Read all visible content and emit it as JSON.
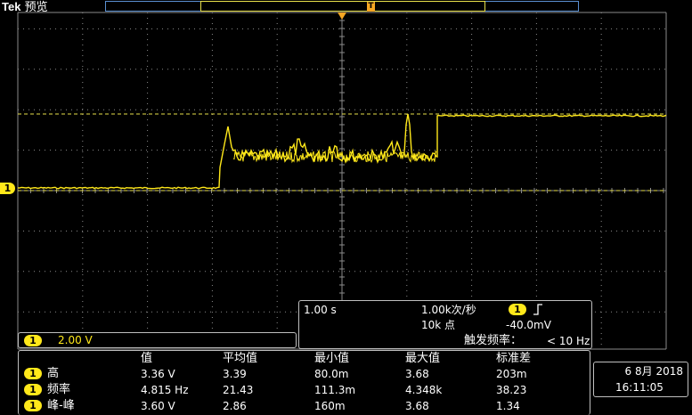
{
  "header": {
    "brand": "Tek",
    "mode": "预览",
    "trigger_position_marker": "T"
  },
  "channel": {
    "number": "1",
    "scale": "2.00 V"
  },
  "acquisition": {
    "time_per_div": "1.00 s",
    "sample_rate": "1.00k次/秒",
    "record_length": "10k 点",
    "trigger_channel": "1",
    "trigger_slope_icon": "rising-edge-icon",
    "trigger_level": "-40.0mV",
    "trigger_freq_label": "触发频率：",
    "trigger_freq_value": "< 10 Hz"
  },
  "measurements": {
    "headers": [
      "值",
      "平均值",
      "最小值",
      "最大值",
      "标准差"
    ],
    "rows": [
      {
        "channel": "1",
        "name": "高",
        "value": "3.36 V",
        "mean": "3.39",
        "min": "80.0m",
        "max": "3.68",
        "std": "203m"
      },
      {
        "channel": "1",
        "name": "频率",
        "value": "4.815 Hz",
        "mean": "21.43",
        "min": "111.3m",
        "max": "4.348k",
        "std": "38.23"
      },
      {
        "channel": "1",
        "name": "峰-峰",
        "value": "3.60 V",
        "mean": "2.86",
        "min": "160m",
        "max": "3.68",
        "std": "1.34"
      }
    ]
  },
  "clock": {
    "date": "6 8月 2018",
    "time": "16:11:05"
  },
  "colors": {
    "trace": "#ffe81a",
    "grid": "#8a8a8a",
    "cursor": "#e8e04a",
    "trigger_marker": "#f5a623"
  }
}
